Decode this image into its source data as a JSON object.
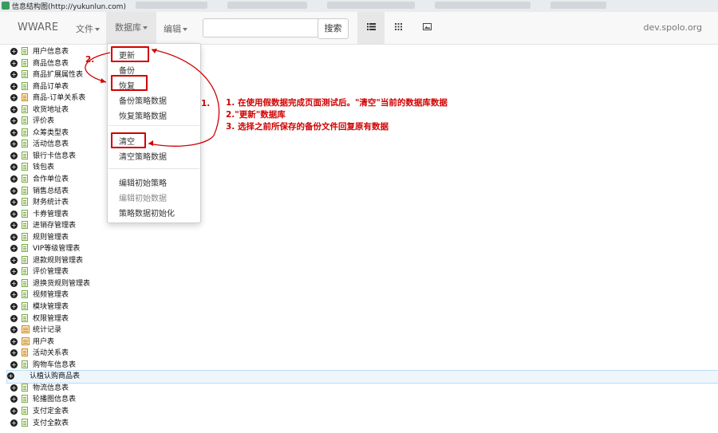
{
  "window": {
    "title": "信息结构图(http://yukunlun.com)"
  },
  "navbar": {
    "brand": "WWARE",
    "menus": [
      {
        "label": "文件"
      },
      {
        "label": "数据库"
      },
      {
        "label": "编辑"
      }
    ],
    "search": {
      "value": "",
      "placeholder": "",
      "button_label": "搜索"
    },
    "view_buttons": [
      {
        "icon": "list-icon"
      },
      {
        "icon": "grid-icon"
      },
      {
        "icon": "image-icon"
      }
    ],
    "site": "dev.spolo.org"
  },
  "dropdown": {
    "items": [
      {
        "label": "更新"
      },
      {
        "label": "备份"
      },
      {
        "label": "恢复"
      },
      {
        "label": "备份策略数据"
      },
      {
        "label": "恢复策略数据"
      },
      {
        "label": "清空"
      },
      {
        "label": "清空策略数据"
      },
      {
        "label": "编辑初始策略"
      },
      {
        "label": "编辑初始数据"
      },
      {
        "label": "策略数据初始化"
      }
    ]
  },
  "tree": {
    "items": [
      {
        "label": "用户信息表",
        "icon": "green"
      },
      {
        "label": "商品信息表",
        "icon": "green"
      },
      {
        "label": "商品扩展属性表",
        "icon": "green"
      },
      {
        "label": "商品订单表",
        "icon": "green"
      },
      {
        "label": "商品-订单关系表",
        "icon": "orange"
      },
      {
        "label": "收货地址表",
        "icon": "green"
      },
      {
        "label": "评价表",
        "icon": "green"
      },
      {
        "label": "众筹类型表",
        "icon": "green"
      },
      {
        "label": "活动信息表",
        "icon": "green"
      },
      {
        "label": "银行卡信息表",
        "icon": "green"
      },
      {
        "label": "钱包表",
        "icon": "green"
      },
      {
        "label": "合作单位表",
        "icon": "green"
      },
      {
        "label": "销售总结表",
        "icon": "green"
      },
      {
        "label": "财务统计表",
        "icon": "green"
      },
      {
        "label": "卡券管理表",
        "icon": "green"
      },
      {
        "label": "进销存管理表",
        "icon": "green"
      },
      {
        "label": "规则管理表",
        "icon": "green"
      },
      {
        "label": "VIP等级管理表",
        "icon": "green"
      },
      {
        "label": "退款规则管理表",
        "icon": "green"
      },
      {
        "label": "评价管理表",
        "icon": "green"
      },
      {
        "label": "退换货规则管理表",
        "icon": "green"
      },
      {
        "label": "视频管理表",
        "icon": "green"
      },
      {
        "label": "模块管理表",
        "icon": "green"
      },
      {
        "label": "权限管理表",
        "icon": "green"
      },
      {
        "label": "统计记录",
        "icon": "multi"
      },
      {
        "label": "用户表",
        "icon": "multi"
      },
      {
        "label": "活动关系表",
        "icon": "orange"
      },
      {
        "label": "购物车信息表",
        "icon": "green"
      },
      {
        "label": "认植认购商品表",
        "icon": "none",
        "selected": true
      },
      {
        "label": "物流信息表",
        "icon": "green"
      },
      {
        "label": "轮播图信息表",
        "icon": "green"
      },
      {
        "label": "支付定金表",
        "icon": "green"
      },
      {
        "label": "支付全款表",
        "icon": "green"
      }
    ]
  },
  "annotations": {
    "step1_marker": "1.",
    "step2_marker": "2.",
    "lines": [
      "1. 在使用假数据完成页面测试后。\"清空\"当前的数据库数据",
      "2.\"更新\"数据库",
      "3. 选择之前所保存的备份文件回复原有数据"
    ],
    "color": "#d10000"
  }
}
